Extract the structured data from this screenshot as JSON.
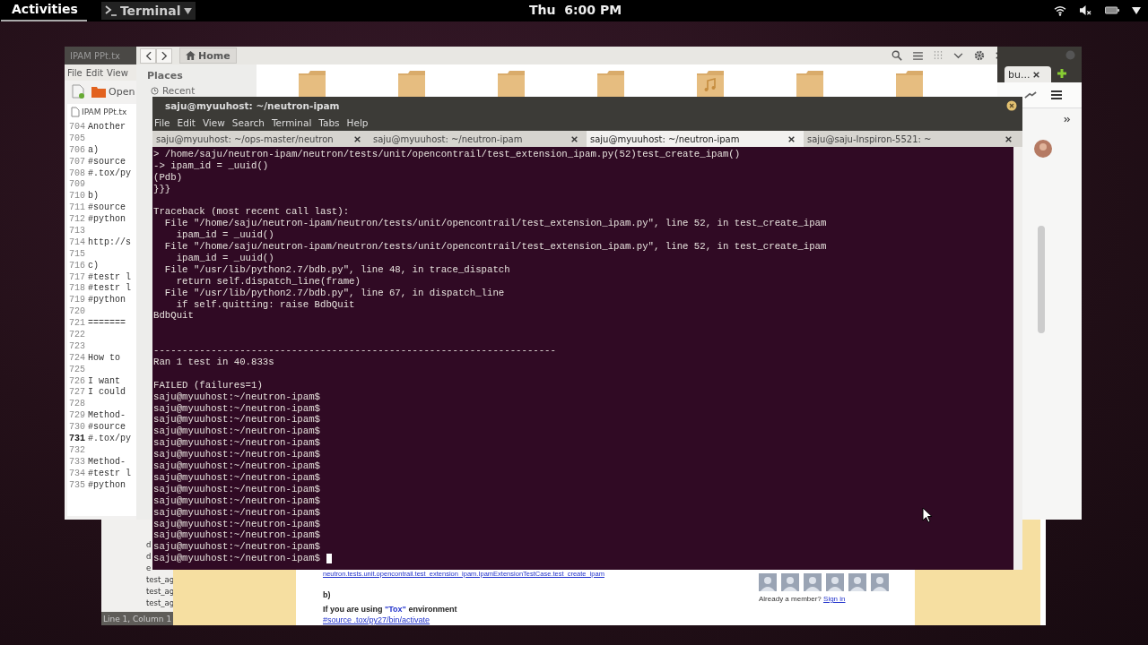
{
  "top_bar": {
    "activities": "Activities",
    "app_menu": "Terminal",
    "clock": "Thu  6:00 PM"
  },
  "text_editor": {
    "title": "IPAM PPt.tx",
    "menu": [
      "File",
      "Edit",
      "View"
    ],
    "open_label": "Open",
    "tab": "IPAM PPt.tx",
    "lines": [
      {
        "number": "704",
        "text": "Another",
        "selected": false
      },
      {
        "number": "705",
        "selected": false
      },
      {
        "number": "706",
        "text": "a)",
        "selected": false
      },
      {
        "number": "707",
        "text": "#source",
        "selected": false
      },
      {
        "number": "708",
        "text": "#.tox/py",
        "selected": false
      },
      {
        "number": "709",
        "selected": false
      },
      {
        "number": "710",
        "text": "b)",
        "selected": false
      },
      {
        "number": "711",
        "text": "#source",
        "selected": false
      },
      {
        "number": "712",
        "text": "#python",
        "selected": false
      },
      {
        "number": "713",
        "selected": false
      },
      {
        "number": "714",
        "text": "http://s",
        "selected": false
      },
      {
        "number": "715",
        "selected": false
      },
      {
        "number": "716",
        "text": "c)",
        "selected": false
      },
      {
        "number": "717",
        "text": "#testr l",
        "selected": false
      },
      {
        "number": "718",
        "text": "#testr l",
        "selected": false
      },
      {
        "number": "719",
        "text": "#python",
        "selected": false
      },
      {
        "number": "720",
        "selected": false
      },
      {
        "number": "721",
        "text": "=======",
        "selected": false
      },
      {
        "number": "722",
        "selected": false
      },
      {
        "number": "723",
        "selected": false
      },
      {
        "number": "724",
        "text": "How to",
        "selected": false
      },
      {
        "number": "725",
        "selected": false
      },
      {
        "number": "726",
        "text": "I want",
        "selected": false
      },
      {
        "number": "727",
        "text": "I could",
        "selected": false
      },
      {
        "number": "728",
        "selected": false
      },
      {
        "number": "729",
        "text": "Method-",
        "selected": false
      },
      {
        "number": "730",
        "text": "#source",
        "selected": false
      },
      {
        "number": "731",
        "text": "#.tox/py",
        "selected": true
      },
      {
        "number": "732",
        "selected": false
      },
      {
        "number": "733",
        "text": "Method-",
        "selected": false
      },
      {
        "number": "734",
        "text": "#testr l",
        "selected": false
      },
      {
        "number": "735",
        "text": "#python",
        "selected": false
      }
    ]
  },
  "file_manager": {
    "location": "Home",
    "sidebar_heading": "Places",
    "sidebar_items": [
      "Recent"
    ],
    "folders": [
      {
        "kind": "folder"
      },
      {
        "kind": "folder"
      },
      {
        "kind": "folder"
      },
      {
        "kind": "folder"
      },
      {
        "kind": "music"
      },
      {
        "kind": "folder"
      },
      {
        "kind": "folder"
      }
    ]
  },
  "browser": {
    "tab": "bu...",
    "sidebar_items": [
      "d",
      "d",
      "e",
      "test_ag",
      "test_ag",
      "test_ag"
    ],
    "status": "Line 1, Column 1",
    "page": {
      "test_path": "neutron.tests.unit.opencontrail.test_extension_ipam.IpamExtensionTestCase.test_create_ipam",
      "heading": "b)",
      "intro": "If you are using",
      "highlight": "\"Tox\"",
      "outro": "environment",
      "command": "#source .tox/py27/bin/activate",
      "member_prompt": "Already a member?",
      "sign_in": "Sign in"
    }
  },
  "terminal": {
    "title": "saju@myuuhost: ~/neutron-ipam",
    "menu": [
      "File",
      "Edit",
      "View",
      "Search",
      "Terminal",
      "Tabs",
      "Help"
    ],
    "tabs": [
      {
        "label": "saju@myuuhost: ~/ops-master/neutron",
        "selected": false
      },
      {
        "label": "saju@myuuhost: ~/neutron-ipam",
        "selected": false
      },
      {
        "label": "saju@myuuhost: ~/neutron-ipam",
        "selected": true
      },
      {
        "label": "saju@saju-Inspiron-5521: ~",
        "selected": false
      }
    ],
    "lines": [
      "> /home/saju/neutron-ipam/neutron/tests/unit/opencontrail/test_extension_ipam.py(52)test_create_ipam()",
      "-> ipam_id = _uuid()",
      "(Pdb)",
      "}}}",
      {
        "kind": "blank"
      },
      "Traceback (most recent call last):",
      "  File \"/home/saju/neutron-ipam/neutron/tests/unit/opencontrail/test_extension_ipam.py\", line 52, in test_create_ipam",
      "    ipam_id = _uuid()",
      "  File \"/home/saju/neutron-ipam/neutron/tests/unit/opencontrail/test_extension_ipam.py\", line 52, in test_create_ipam",
      "    ipam_id = _uuid()",
      "  File \"/usr/lib/python2.7/bdb.py\", line 48, in trace_dispatch",
      "    return self.dispatch_line(frame)",
      "  File \"/usr/lib/python2.7/bdb.py\", line 67, in dispatch_line",
      "    if self.quitting: raise BdbQuit",
      "BdbQuit",
      {
        "kind": "blank"
      },
      {
        "kind": "blank"
      },
      "----------------------------------------------------------------------",
      "Ran 1 test in 40.833s",
      {
        "kind": "blank"
      },
      "FAILED (failures=1)",
      "saju@myuuhost:~/neutron-ipam$",
      "saju@myuuhost:~/neutron-ipam$",
      "saju@myuuhost:~/neutron-ipam$",
      "saju@myuuhost:~/neutron-ipam$",
      "saju@myuuhost:~/neutron-ipam$",
      "saju@myuuhost:~/neutron-ipam$",
      "saju@myuuhost:~/neutron-ipam$",
      "saju@myuuhost:~/neutron-ipam$",
      "saju@myuuhost:~/neutron-ipam$",
      "saju@myuuhost:~/neutron-ipam$",
      "saju@myuuhost:~/neutron-ipam$",
      "saju@myuuhost:~/neutron-ipam$",
      "saju@myuuhost:~/neutron-ipam$",
      "saju@myuuhost:~/neutron-ipam$",
      "saju@myuuhost:~/neutron-ipam$"
    ],
    "cursor": true
  }
}
